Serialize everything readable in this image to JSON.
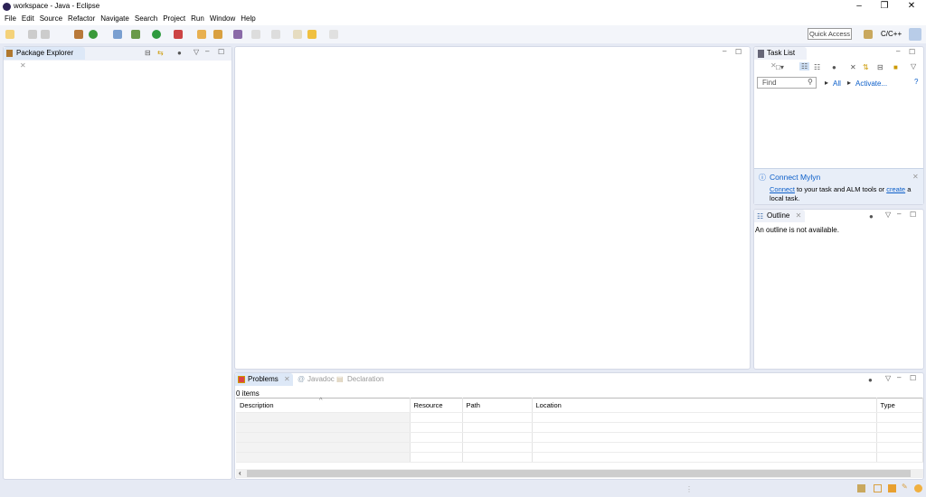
{
  "window": {
    "title": "workspace - Java - Eclipse",
    "minimize": "–",
    "maximize": "❐",
    "close": "✕"
  },
  "menu": [
    "File",
    "Edit",
    "Source",
    "Refactor",
    "Navigate",
    "Search",
    "Project",
    "Run",
    "Window",
    "Help"
  ],
  "toolbar": {
    "quick_access": "Quick Access",
    "perspective_cpp": "C/C++"
  },
  "package_explorer": {
    "title": "Package Explorer"
  },
  "task_list": {
    "title": "Task List",
    "find_placeholder": "Find",
    "all": "All",
    "activate": "Activate..."
  },
  "mylyn": {
    "title": "Connect Mylyn",
    "connect": "Connect",
    "middle": " to your task and ALM tools or ",
    "create": "create",
    "end": " a local task."
  },
  "outline": {
    "title": "Outline",
    "message": "An outline is not available."
  },
  "problems": {
    "tabs": [
      "Problems",
      "Javadoc",
      "Declaration"
    ],
    "count": "0 items",
    "columns": [
      "Description",
      "Resource",
      "Path",
      "Location",
      "Type"
    ]
  }
}
